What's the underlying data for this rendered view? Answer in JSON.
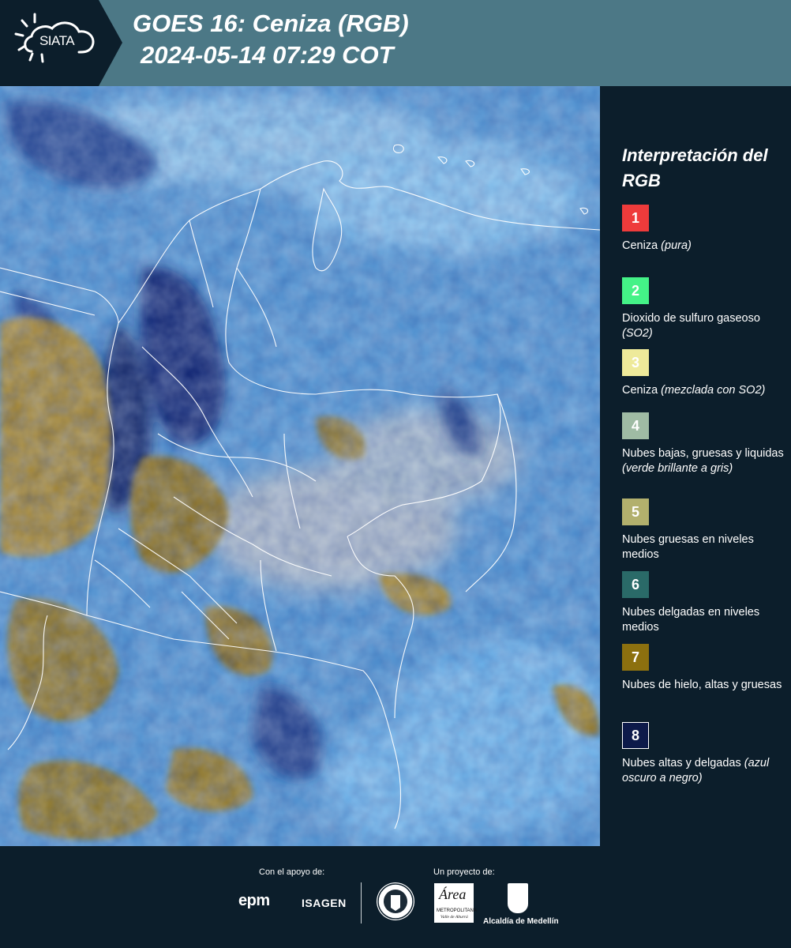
{
  "header": {
    "logo": "SIATA",
    "title": "GOES 16: Ceniza (RGB)",
    "subtitle": "2024-05-14 07:29 COT",
    "background_color": "#4c7886",
    "logo_background_color": "#0c1e2b"
  },
  "legend": {
    "title": "Interpretación del RGB",
    "items": [
      {
        "number": "1",
        "label": "Ceniza ",
        "note": "(pura)",
        "color": "#ee3b3b",
        "text_color": "#ffffff"
      },
      {
        "number": "2",
        "label": "Dioxido de sulfuro gaseoso ",
        "note": "(SO2)",
        "color": "#44f287",
        "text_color": "#ffffff"
      },
      {
        "number": "3",
        "label": "Ceniza ",
        "note": "(mezclada con SO2)",
        "color": "#eeea9a",
        "text_color": "#ffffff"
      },
      {
        "number": "4",
        "label": "Nubes bajas, gruesas y liquidas ",
        "note": "(verde brillante a gris)",
        "color": "#9fbba4",
        "text_color": "#ffffff"
      },
      {
        "number": "5",
        "label": "Nubes gruesas en niveles medios",
        "note": "",
        "color": "#b2b06d",
        "text_color": "#ffffff"
      },
      {
        "number": "6",
        "label": "Nubes delgadas en niveles medios",
        "note": "",
        "color": "#2a6a68",
        "text_color": "#ffffff"
      },
      {
        "number": "7",
        "label": "Nubes de hielo, altas y gruesas",
        "note": "",
        "color": "#8c700f",
        "text_color": "#ffffff"
      },
      {
        "number": "8",
        "label": "Nubes altas y delgadas ",
        "note": "(azul oscuro a negro)",
        "color": "#0d1a4a",
        "text_color": "#ffffff"
      }
    ]
  },
  "footer": {
    "support_label": "Con el apoyo de:",
    "project_label": "Un proyecto de:",
    "sponsors": [
      "epm",
      "ISAGEN"
    ],
    "partners": [
      "Área Metropolitana Valle de Aburrá",
      "Alcaldía de Medellín"
    ],
    "area_logo_title": "Área",
    "area_logo_sub": "METROPOLITANA",
    "area_logo_sub2": "Valle de Aburrá",
    "alcaldia_text": "Alcaldía de Medellín"
  },
  "map": {
    "base_color": "#4f90cf",
    "ice_cloud_color": "#9a7a2a",
    "thin_high_cloud_color": "#0d1e6a",
    "border_color": "#ffffff"
  }
}
